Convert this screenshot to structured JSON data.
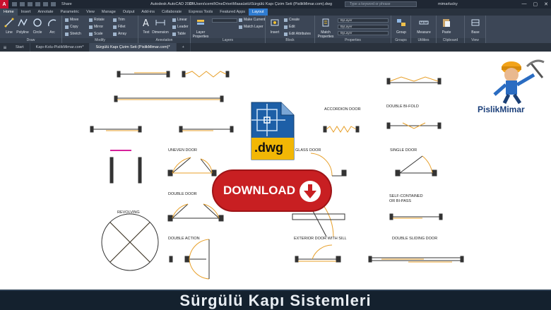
{
  "window": {
    "logo": "A",
    "share": "Share",
    "app_name": "Autodesk AutoCAD 2024",
    "file_path": "C:\\Users\\cemil\\OneDrive\\Masaüstü\\Sürgülü Kapı Çizim Seti (PislikMimar.com).dwg",
    "search_placeholder": "Type a keyword or phrase",
    "user": "mimarlucky",
    "controls": [
      "—",
      "▢",
      "✕"
    ]
  },
  "ribbon_tabs": [
    "Home",
    "Insert",
    "Annotate",
    "Parametric",
    "View",
    "Manage",
    "Output",
    "Add-ins",
    "Collaborate",
    "Express Tools",
    "Featured Apps",
    "Layout"
  ],
  "active_tab": "Home",
  "ribbon": {
    "draw": {
      "label": "Draw",
      "tools": [
        "Line",
        "Polyline",
        "Circle",
        "Arc"
      ]
    },
    "modify": {
      "label": "Modify",
      "tools": [
        "Move",
        "Rotate",
        "Trim",
        "Copy",
        "Mirror",
        "Fillet",
        "Stretch",
        "Scale",
        "Array"
      ]
    },
    "annotation": {
      "label": "Annotation",
      "tools": [
        "Text",
        "Dimension",
        "Linear",
        "Leader",
        "Table"
      ]
    },
    "layers": {
      "label": "Layers",
      "tools": [
        "Layer Properties",
        "Make Current",
        "Match Layer"
      ]
    },
    "block": {
      "label": "Block",
      "tools": [
        "Insert",
        "Create",
        "Edit",
        "Edit Attributes"
      ]
    },
    "properties": {
      "label": "Properties",
      "tools": [
        "Match Properties"
      ],
      "dropdowns": [
        "ByLayer",
        "ByLayer",
        "ByLayer"
      ]
    },
    "groups": {
      "label": "Groups",
      "tools": [
        "Group"
      ]
    },
    "utilities": {
      "label": "Utilities",
      "tools": [
        "Measure"
      ]
    },
    "clipboard": {
      "label": "Clipboard",
      "tools": [
        "Paste"
      ]
    },
    "view": {
      "label": "View",
      "tools": [
        "Base"
      ]
    }
  },
  "doc_tabs": [
    "Start",
    "Kapı-Kolu-PislikMimar.com*",
    "Sürgülü Kapı Çizim Seti (PislikMimar.com)*",
    "+"
  ],
  "drawing_labels": {
    "accordion": "ACCORDION DOOR",
    "double_bifold": "DOUBLE BI-FOLD",
    "uneven": "UNEVEN DOOR",
    "glass": "GLASS DOOR",
    "single": "SINGLE DOOR",
    "double": "DOUBLE DOOR",
    "self_contained": "SELF-CONTAINED\nOR BI-PASS",
    "revolving": "REVOLVING",
    "double_action": "DOUBLE ACTION",
    "exterior_sill": "EXTERIOR DOOR WITH SILL",
    "double_sliding": "DOUBLE SLIDING DOOR"
  },
  "overlay": {
    "file_type": ".dwg",
    "download": "DOWNLOAD",
    "brand": "PislikMimar"
  },
  "banner": {
    "title": "Sürgülü Kapı Sistemleri"
  },
  "colors": {
    "accent_red": "#c81f22",
    "ribbon_bg": "#3c4656",
    "door_orange": "#e8a02a",
    "banner_bg": "#14212e"
  }
}
